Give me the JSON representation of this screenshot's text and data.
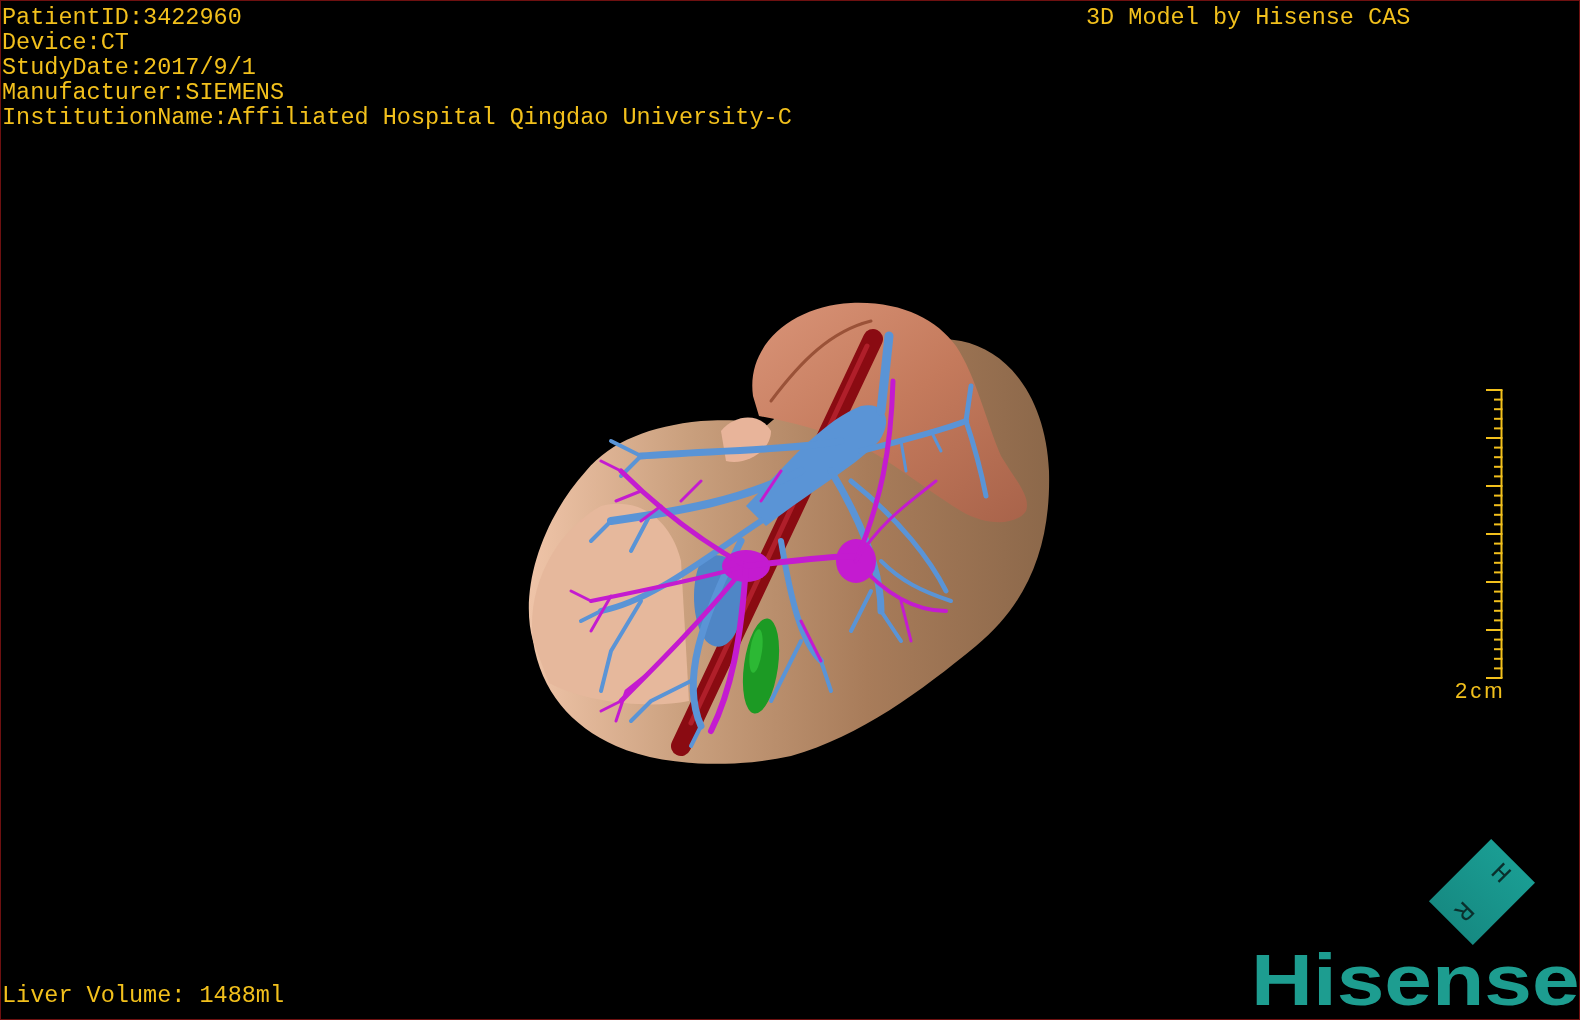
{
  "overlay": {
    "info_lines": [
      "PatientID:3422960",
      "Device:CT",
      "StudyDate:2017/9/1",
      "Manufacturer:SIEMENS",
      "InstitutionName:Affiliated Hospital Qingdao University-C"
    ],
    "credit": "3D Model by Hisense CAS",
    "liver_volume": "Liver Volume: 1488ml"
  },
  "scale_bar": {
    "label": "2cm"
  },
  "orientation_cube": {
    "labels": [
      "R",
      "H"
    ]
  },
  "logo": {
    "text": "Hisense"
  }
}
